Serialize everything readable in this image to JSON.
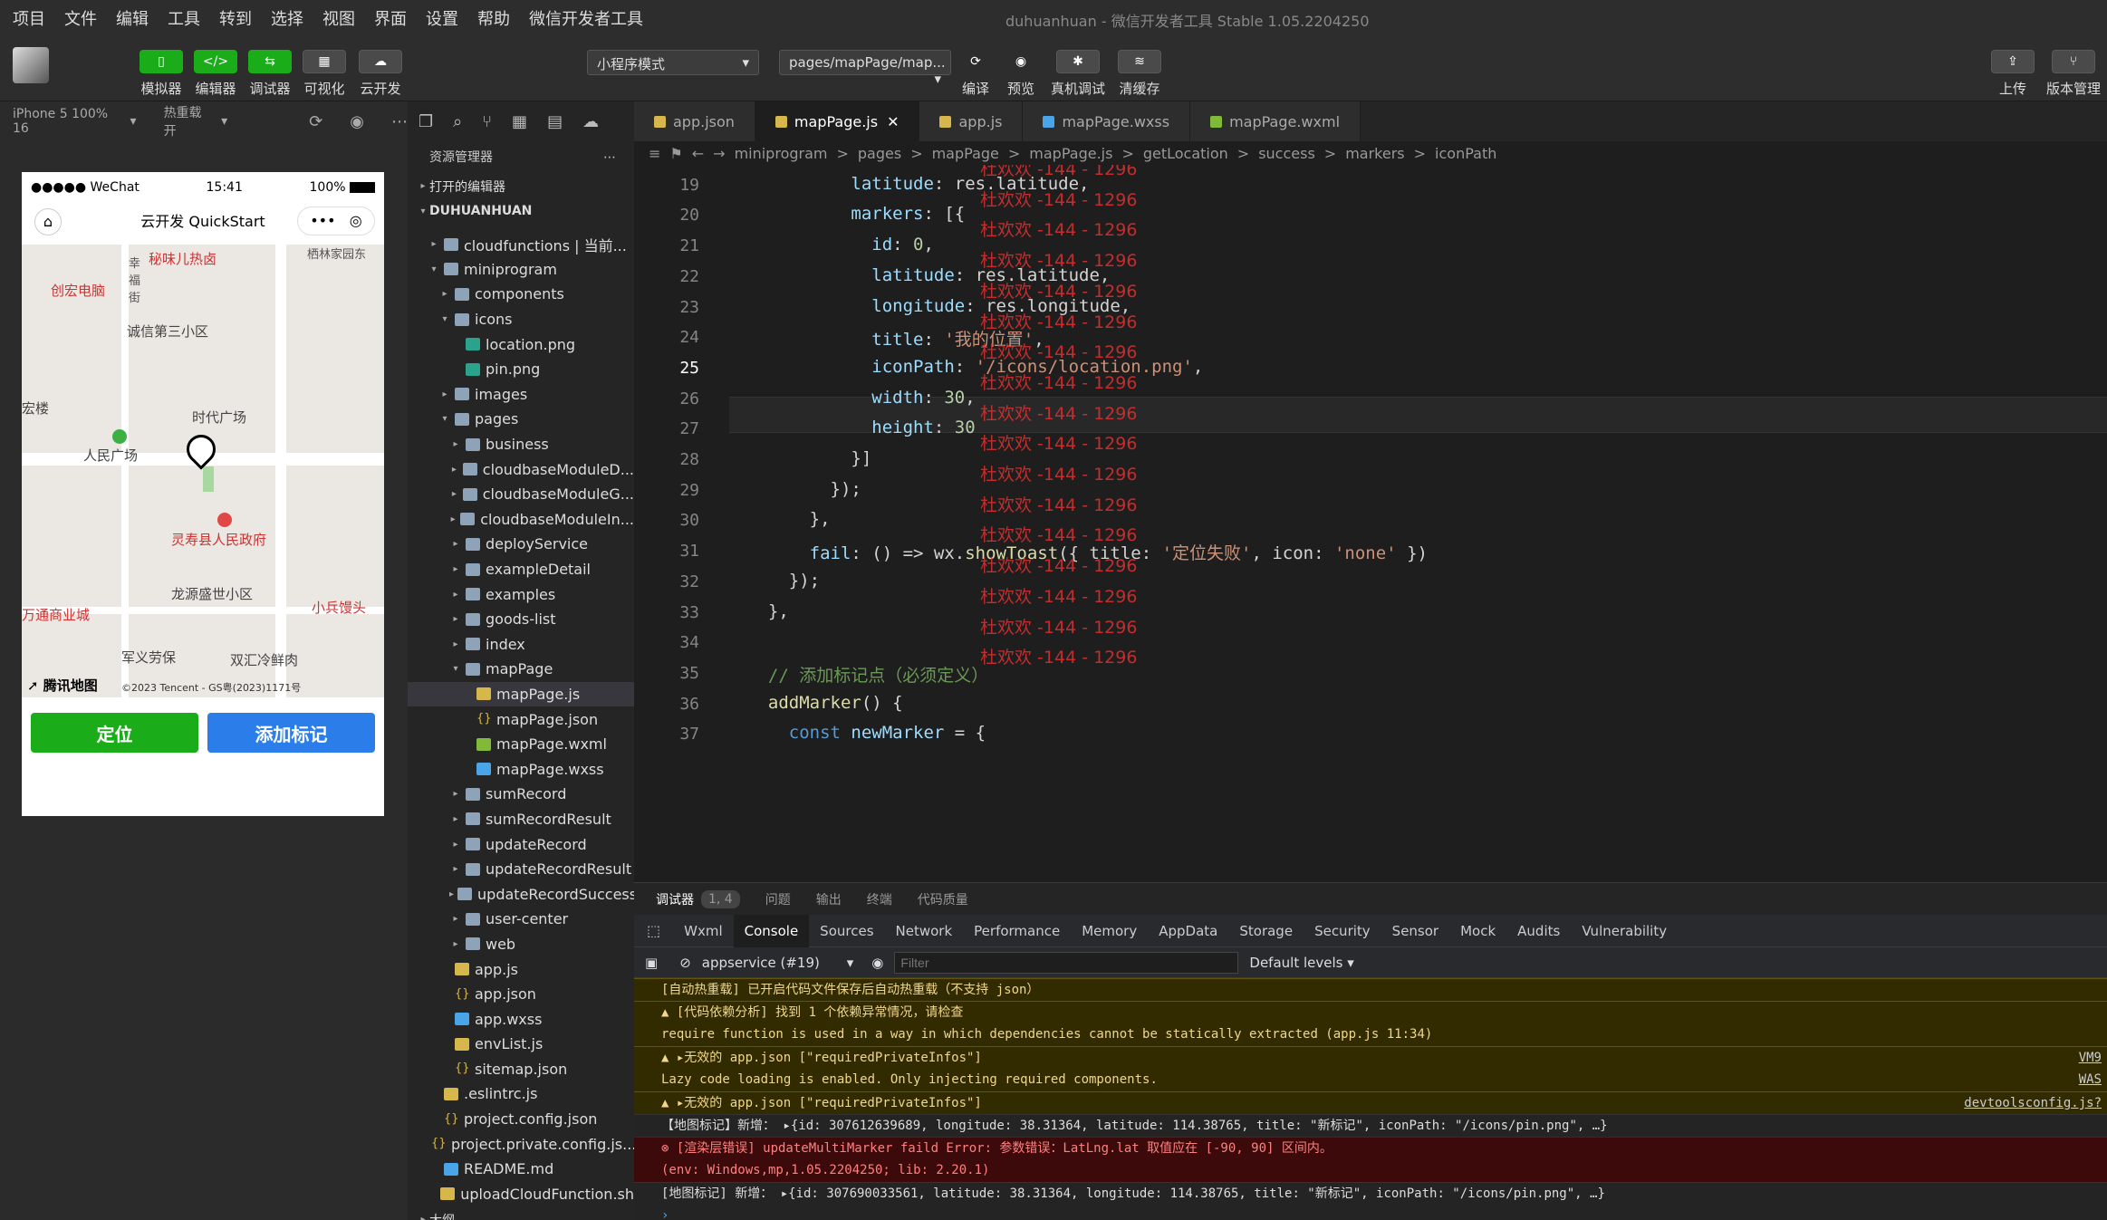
{
  "menu": [
    "项目",
    "文件",
    "编辑",
    "工具",
    "转到",
    "选择",
    "视图",
    "界面",
    "设置",
    "帮助",
    "微信开发者工具"
  ],
  "window_title": "duhuanhuan - 微信开发者工具 Stable 1.05.2204250",
  "toolbar": {
    "left": [
      "模拟器",
      "编辑器",
      "调试器",
      "可视化",
      "云开发"
    ],
    "mode": "小程序模式",
    "page": "pages/mapPage/map...",
    "actions": [
      "编译",
      "预览",
      "真机调试",
      "清缓存"
    ],
    "right": [
      "上传",
      "版本管理"
    ]
  },
  "simbar": {
    "device": "iPhone 5 100% 16",
    "hotreload": "热重载 开"
  },
  "phone": {
    "carrier": "●●●●● WeChat",
    "time": "15:41",
    "battery": "100%",
    "nav_title": "云开发 QuickStart",
    "map_labels": [
      "秘味儿热卤",
      "创宏电脑",
      "幸福街",
      "诚信第三小区",
      "宏楼",
      "时代广场",
      "人民广场",
      "灵寿县人民政府",
      "龙源盛世小区",
      "万通商业城",
      "小兵馒头",
      "军义劳保",
      "双汇冷鲜肉",
      "栖林家园东",
      "腾讯地图",
      "©2023 Tencent - GS粤(2023)1171号"
    ],
    "btn_locate": "定位",
    "btn_add": "添加标记",
    "colors": {
      "green": "#1aad19",
      "blue": "#2b7ee9"
    }
  },
  "explorer": {
    "header": "资源管理器",
    "open_editors": "打开的编辑器",
    "root": "DUHUANHUAN",
    "items": [
      {
        "label": "cloudfunctions | 当前...",
        "type": "folder",
        "depth": 1,
        "arrow": "▸"
      },
      {
        "label": "miniprogram",
        "type": "folder",
        "depth": 1,
        "arrow": "▾"
      },
      {
        "label": "components",
        "type": "folder",
        "depth": 2,
        "arrow": "▸"
      },
      {
        "label": "icons",
        "type": "folder",
        "depth": 2,
        "arrow": "▾"
      },
      {
        "label": "location.png",
        "type": "png",
        "depth": 3,
        "arrow": ""
      },
      {
        "label": "pin.png",
        "type": "png",
        "depth": 3,
        "arrow": ""
      },
      {
        "label": "images",
        "type": "folder",
        "depth": 2,
        "arrow": "▸"
      },
      {
        "label": "pages",
        "type": "folder",
        "depth": 2,
        "arrow": "▾"
      },
      {
        "label": "business",
        "type": "folder",
        "depth": 3,
        "arrow": "▸"
      },
      {
        "label": "cloudbaseModuleD...",
        "type": "folder",
        "depth": 3,
        "arrow": "▸"
      },
      {
        "label": "cloudbaseModuleG...",
        "type": "folder",
        "depth": 3,
        "arrow": "▸"
      },
      {
        "label": "cloudbaseModuleIn...",
        "type": "folder",
        "depth": 3,
        "arrow": "▸"
      },
      {
        "label": "deployService",
        "type": "folder",
        "depth": 3,
        "arrow": "▸"
      },
      {
        "label": "exampleDetail",
        "type": "folder",
        "depth": 3,
        "arrow": "▸"
      },
      {
        "label": "examples",
        "type": "folder",
        "depth": 3,
        "arrow": "▸"
      },
      {
        "label": "goods-list",
        "type": "folder",
        "depth": 3,
        "arrow": "▸"
      },
      {
        "label": "index",
        "type": "folder",
        "depth": 3,
        "arrow": "▸"
      },
      {
        "label": "mapPage",
        "type": "folder",
        "depth": 3,
        "arrow": "▾"
      },
      {
        "label": "mapPage.js",
        "type": "js",
        "depth": 4,
        "arrow": "",
        "selected": true
      },
      {
        "label": "mapPage.json",
        "type": "json",
        "depth": 4,
        "arrow": ""
      },
      {
        "label": "mapPage.wxml",
        "type": "wxml",
        "depth": 4,
        "arrow": ""
      },
      {
        "label": "mapPage.wxss",
        "type": "wxss",
        "depth": 4,
        "arrow": ""
      },
      {
        "label": "sumRecord",
        "type": "folder",
        "depth": 3,
        "arrow": "▸"
      },
      {
        "label": "sumRecordResult",
        "type": "folder",
        "depth": 3,
        "arrow": "▸"
      },
      {
        "label": "updateRecord",
        "type": "folder",
        "depth": 3,
        "arrow": "▸"
      },
      {
        "label": "updateRecordResult",
        "type": "folder",
        "depth": 3,
        "arrow": "▸"
      },
      {
        "label": "updateRecordSuccess",
        "type": "folder",
        "depth": 3,
        "arrow": "▸"
      },
      {
        "label": "user-center",
        "type": "folder",
        "depth": 3,
        "arrow": "▸"
      },
      {
        "label": "web",
        "type": "folder",
        "depth": 3,
        "arrow": "▸"
      },
      {
        "label": "app.js",
        "type": "js",
        "depth": 2,
        "arrow": ""
      },
      {
        "label": "app.json",
        "type": "json",
        "depth": 2,
        "arrow": ""
      },
      {
        "label": "app.wxss",
        "type": "wxss",
        "depth": 2,
        "arrow": ""
      },
      {
        "label": "envList.js",
        "type": "js",
        "depth": 2,
        "arrow": ""
      },
      {
        "label": "sitemap.json",
        "type": "json",
        "depth": 2,
        "arrow": ""
      },
      {
        "label": ".eslintrc.js",
        "type": "js",
        "depth": 1,
        "arrow": ""
      },
      {
        "label": "project.config.json",
        "type": "json",
        "depth": 1,
        "arrow": ""
      },
      {
        "label": "project.private.config.js...",
        "type": "json",
        "depth": 1,
        "arrow": ""
      },
      {
        "label": "README.md",
        "type": "md",
        "depth": 1,
        "arrow": ""
      },
      {
        "label": "uploadCloudFunction.sh",
        "type": "sh",
        "depth": 1,
        "arrow": ""
      }
    ],
    "footer": "大纲"
  },
  "tabs": [
    {
      "label": "app.json",
      "type": "json",
      "active": false
    },
    {
      "label": "mapPage.js",
      "type": "js",
      "active": true
    },
    {
      "label": "app.js",
      "type": "js",
      "active": false
    },
    {
      "label": "mapPage.wxss",
      "type": "wxss",
      "active": false
    },
    {
      "label": "mapPage.wxml",
      "type": "wxml",
      "active": false
    }
  ],
  "breadcrumb": [
    "miniprogram",
    ">",
    "pages",
    ">",
    "mapPage",
    ">",
    "mapPage.js",
    ">",
    "getLocation",
    ">",
    "success",
    ">",
    "markers",
    ">",
    "iconPath"
  ],
  "code": {
    "current_line": "25",
    "lines": [
      {
        "n": "",
        "t": [
          [
            "plain",
            "          longitude: res.longitude,"
          ]
        ]
      },
      {
        "n": "19",
        "t": [
          [
            "prop",
            "          latitude"
          ],
          [
            "plain",
            ": res.latitude,"
          ]
        ]
      },
      {
        "n": "20",
        "t": [
          [
            "prop",
            "          markers"
          ],
          [
            "plain",
            ": [{"
          ]
        ]
      },
      {
        "n": "21",
        "t": [
          [
            "prop",
            "            id"
          ],
          [
            "plain",
            ": "
          ],
          [
            "num",
            "0"
          ],
          [
            "plain",
            ","
          ]
        ]
      },
      {
        "n": "22",
        "t": [
          [
            "prop",
            "            latitude"
          ],
          [
            "plain",
            ": res.latitude,"
          ]
        ]
      },
      {
        "n": "23",
        "t": [
          [
            "prop",
            "            longitude"
          ],
          [
            "plain",
            ": res.longitude,"
          ]
        ]
      },
      {
        "n": "24",
        "t": [
          [
            "prop",
            "            title"
          ],
          [
            "plain",
            ": "
          ],
          [
            "str",
            "'我的位置'"
          ],
          [
            "plain",
            ","
          ]
        ]
      },
      {
        "n": "25",
        "t": [
          [
            "prop",
            "            iconPath"
          ],
          [
            "plain",
            ": "
          ],
          [
            "str",
            "'/icons/location.png'"
          ],
          [
            "plain",
            ","
          ]
        ]
      },
      {
        "n": "26",
        "t": [
          [
            "prop",
            "            width"
          ],
          [
            "plain",
            ": "
          ],
          [
            "num",
            "30"
          ],
          [
            "plain",
            ","
          ]
        ]
      },
      {
        "n": "27",
        "t": [
          [
            "prop",
            "            height"
          ],
          [
            "plain",
            ": "
          ],
          [
            "num",
            "30"
          ]
        ]
      },
      {
        "n": "28",
        "t": [
          [
            "plain",
            "          }]"
          ]
        ]
      },
      {
        "n": "29",
        "t": [
          [
            "plain",
            "        });"
          ]
        ]
      },
      {
        "n": "30",
        "t": [
          [
            "plain",
            "      },"
          ]
        ]
      },
      {
        "n": "31",
        "t": [
          [
            "prop",
            "      fail"
          ],
          [
            "plain",
            ": () => wx."
          ],
          [
            "fn",
            "showToast"
          ],
          [
            "plain",
            "({ title: "
          ],
          [
            "str",
            "'定位失败'"
          ],
          [
            "plain",
            ", icon: "
          ],
          [
            "str",
            "'none'"
          ],
          [
            "plain",
            " })"
          ]
        ]
      },
      {
        "n": "32",
        "t": [
          [
            "plain",
            "    });"
          ]
        ]
      },
      {
        "n": "33",
        "t": [
          [
            "plain",
            "  },"
          ]
        ]
      },
      {
        "n": "34",
        "t": [
          [
            "plain",
            ""
          ]
        ]
      },
      {
        "n": "35",
        "t": [
          [
            "cm",
            "  // 添加标记点（必须定义）"
          ]
        ]
      },
      {
        "n": "36",
        "t": [
          [
            "fn",
            "  addMarker"
          ],
          [
            "plain",
            "() {"
          ]
        ]
      },
      {
        "n": "37",
        "t": [
          [
            "kw",
            "    const "
          ],
          [
            "prop",
            "newMarker"
          ],
          [
            "plain",
            " = {"
          ]
        ]
      }
    ],
    "watermark": "杜欢欢 -144 - 1296"
  },
  "devtools": {
    "top_tabs": [
      "调试器",
      "1, 4",
      "问题",
      "输出",
      "终端",
      "代码质量"
    ],
    "tabs": [
      "Wxml",
      "Console",
      "Sources",
      "Network",
      "Performance",
      "Memory",
      "AppData",
      "Storage",
      "Security",
      "Sensor",
      "Mock",
      "Audits",
      "Vulnerability"
    ],
    "active_tab": "Console",
    "context": "appservice (#19)",
    "filter_placeholder": "Filter",
    "levels": "Default levels",
    "console": [
      {
        "kind": "warn",
        "text": "[自动热重载] 已开启代码文件保存后自动热重载（不支持 json）",
        "link": ""
      },
      {
        "kind": "warn",
        "text": "▲ [代码依赖分析] 找到 1 个依赖异常情况，请检查",
        "link": ""
      },
      {
        "kind": "warn2",
        "text": "require function is used in a way in which dependencies cannot be statically extracted (app.js 11:34)",
        "link": ""
      },
      {
        "kind": "warn",
        "text": "▲ ▸无效的 app.json [\"requiredPrivateInfos\"]",
        "link": "VM9"
      },
      {
        "kind": "warn2",
        "text": "Lazy code loading is enabled. Only injecting required components.",
        "link": "WAS"
      },
      {
        "kind": "warn",
        "text": "▲ ▸无效的 app.json [\"requiredPrivateInfos\"]",
        "link": "devtoolsconfig.js?"
      },
      {
        "kind": "info",
        "text": "【地图标记】新增： ▸{id: 307612639689, longitude: 38.31364, latitude: 114.38765, title: \"新标记\", iconPath: \"/icons/pin.png\", …}",
        "link": ""
      },
      {
        "kind": "err",
        "text": "⊗ [渲染层错误] updateMultiMarker faild Error: 参数错误：LatLng.lat 取值应在 [-90, 90] 区间内。",
        "link": ""
      },
      {
        "kind": "err2",
        "text": "(env: Windows,mp,1.05.2204250; lib: 2.20.1)",
        "link": ""
      },
      {
        "kind": "info",
        "text": "[地图标记] 新增： ▸{id: 307690033561, latitude: 38.31364, longitude: 114.38765, title: \"新标记\", iconPath: \"/icons/pin.png\", …}",
        "link": ""
      },
      {
        "kind": "prompt",
        "text": "›",
        "link": ""
      }
    ]
  }
}
